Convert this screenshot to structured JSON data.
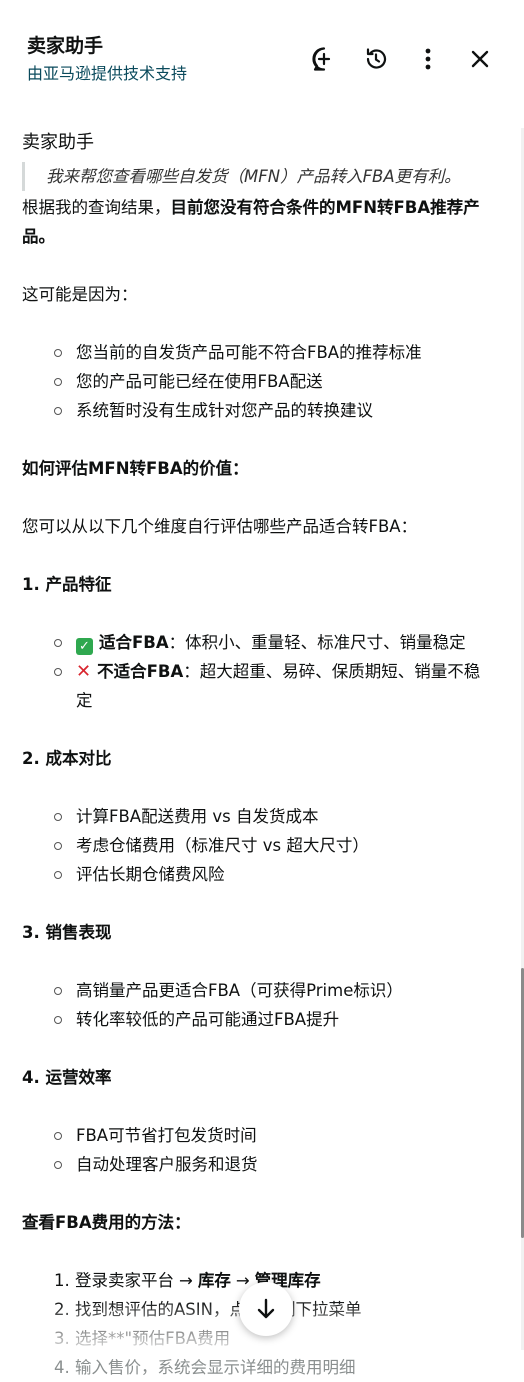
{
  "header": {
    "title": "卖家助手",
    "subtitle": "由亚马逊提供技术支持",
    "icons": [
      "new-chat-icon",
      "history-icon",
      "more-icon",
      "close-icon"
    ]
  },
  "message": {
    "sender": "卖家助手",
    "quote": "我来帮您查看哪些自发货（MFN）产品转入FBA更有利。",
    "intro_prefix": "根据我的查询结果，",
    "intro_bold": "目前您没有符合条件的MFN转FBA推荐产品。",
    "reason_heading": "这可能是因为：",
    "reasons": [
      "您当前的自发货产品可能不符合FBA的推荐标准",
      "您的产品可能已经在使用FBA配送",
      "系统暂时没有生成针对您产品的转换建议"
    ],
    "evaluate_heading": "如何评估MFN转FBA的价值：",
    "evaluate_intro": "您可以从以下几个维度自行评估哪些产品适合转FBA：",
    "sections": [
      {
        "title": "1. 产品特征",
        "items": [
          {
            "icon": "check-icon",
            "label": "适合FBA",
            "text": "：体积小、重量轻、标准尺寸、销量稳定"
          },
          {
            "icon": "cross-icon",
            "label": "不适合FBA",
            "text": "：超大超重、易碎、保质期短、销量不稳定"
          }
        ]
      },
      {
        "title": "2. 成本对比",
        "items": [
          {
            "text": "计算FBA配送费用 vs 自发货成本"
          },
          {
            "text": "考虑仓储费用（标准尺寸 vs 超大尺寸）"
          },
          {
            "text": "评估长期仓储费风险"
          }
        ]
      },
      {
        "title": "3. 销售表现",
        "items": [
          {
            "text": "高销量产品更适合FBA（可获得Prime标识）"
          },
          {
            "text": "转化率较低的产品可能通过FBA提升"
          }
        ]
      },
      {
        "title": "4. 运营效率",
        "items": [
          {
            "text": "FBA可节省打包发货时间"
          },
          {
            "text": "自动处理客户服务和退货"
          }
        ]
      }
    ],
    "fee_heading": "查看FBA费用的方法：",
    "steps": [
      {
        "num": "1.",
        "prefix": "登录卖家平台",
        "arrow1": "→",
        "bold1": "库存",
        "arrow2": "→",
        "bold2": "管理库存"
      },
      {
        "num": "2.",
        "text": "找到想评估的ASIN，点击右侧下拉菜单"
      },
      {
        "num": "3.",
        "text": "选择**\"预估FBA费用"
      },
      {
        "num": "4.",
        "text": "输入售价，系统会显示详细的费用明细"
      }
    ]
  },
  "scroll_button": {
    "icon": "arrow-down-icon"
  }
}
